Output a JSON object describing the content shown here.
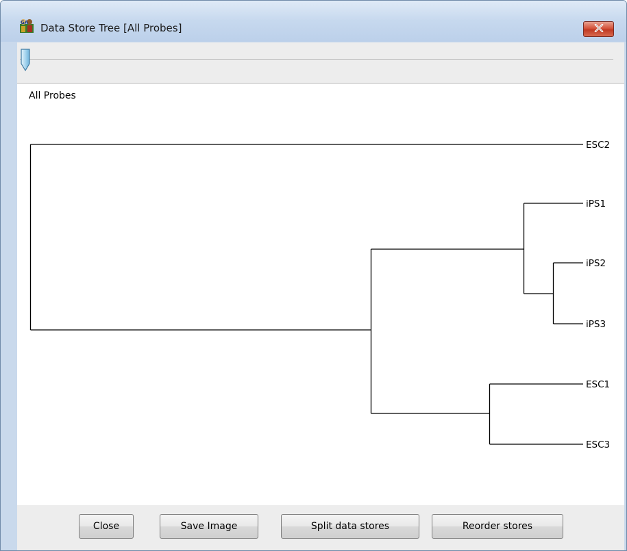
{
  "window": {
    "title": "Data Store Tree [All Probes]",
    "app_icon": "seqmonk-icon",
    "close_icon": "close-icon"
  },
  "slider": {
    "value": 0
  },
  "content": {
    "probe_list_label": "All Probes"
  },
  "tree": {
    "leaves": [
      "ESC2",
      "iPS1",
      "iPS2",
      "iPS3",
      "ESC1",
      "ESC3"
    ]
  },
  "buttons": {
    "close": "Close",
    "save_image": "Save Image",
    "split_data_stores": "Split data stores",
    "reorder_stores": "Reorder stores"
  },
  "colors": {
    "title_bar": "#c6d8ee",
    "close_button": "#c03a23",
    "content_bg": "#ffffff"
  }
}
